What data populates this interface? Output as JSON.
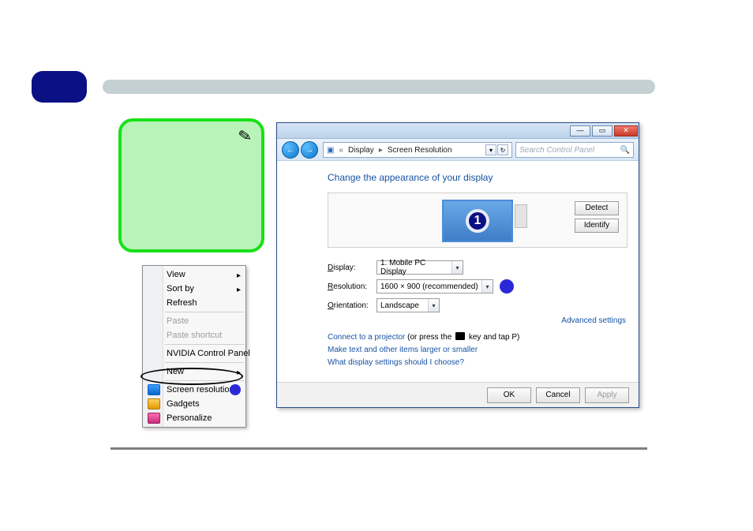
{
  "context_menu": {
    "view": "View",
    "sort": "Sort by",
    "refresh": "Refresh",
    "paste": "Paste",
    "paste_shortcut": "Paste shortcut",
    "nvidia": "NVIDIA Control Panel",
    "new": "New",
    "screen_res": "Screen resolution",
    "gadgets": "Gadgets",
    "personalize": "Personalize"
  },
  "window": {
    "titlebar": {
      "min": "—",
      "max": "▭",
      "close": "✕"
    },
    "nav": {
      "back": "←",
      "fwd": "→"
    },
    "breadcrumb": {
      "root_icon": "▣",
      "prefix": "«",
      "c1": "Display",
      "c2": "Screen Resolution"
    },
    "search_placeholder": "Search Control Panel",
    "heading": "Change the appearance of your display",
    "monitor_number": "1",
    "detect": "Detect",
    "identify": "Identify",
    "labels": {
      "display": "Display:",
      "resolution": "Resolution:",
      "orientation": "Orientation:"
    },
    "values": {
      "display": "1. Mobile PC Display",
      "resolution": "1600 × 900 (recommended)",
      "orientation": "Landscape"
    },
    "advanced": "Advanced settings",
    "hints": {
      "projector_link": "Connect to a projector",
      "projector_tail_a": " (or press the ",
      "projector_tail_b": " key and tap P)",
      "textsize": "Make text and other items larger or smaller",
      "whatsettings": "What display settings should I choose?"
    },
    "buttons": {
      "ok": "OK",
      "cancel": "Cancel",
      "apply": "Apply"
    }
  }
}
